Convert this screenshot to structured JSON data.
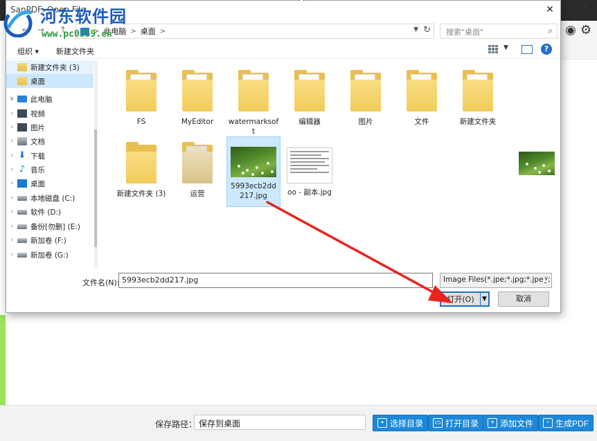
{
  "dialog": {
    "title": "SanPDF: Open File",
    "close_glyph": "✕",
    "nav": {
      "back": "←",
      "forward": "→",
      "up": "↑"
    },
    "address": {
      "segments": [
        "此电脑",
        "桌面"
      ],
      "sep": ">"
    },
    "search": {
      "placeholder": "搜索\"桌面\""
    },
    "toolbar": {
      "organize": "组织 ▾",
      "new_folder": "新建文件夹"
    },
    "help": "?",
    "nav_pane": [
      {
        "label": "新建文件夹 (3)",
        "icon": "folder-icon"
      },
      {
        "label": "桌面",
        "icon": "folder-icon"
      },
      {
        "label": "此电脑",
        "icon": "computer-icon"
      },
      {
        "label": "视频",
        "icon": "video-icon"
      },
      {
        "label": "图片",
        "icon": "pictures-icon"
      },
      {
        "label": "文档",
        "icon": "documents-icon"
      },
      {
        "label": "下载",
        "icon": "download-icon"
      },
      {
        "label": "音乐",
        "icon": "music-icon"
      },
      {
        "label": "桌面",
        "icon": "desktop-icon"
      },
      {
        "label": "本地磁盘 (C:)",
        "icon": "drive-icon"
      },
      {
        "label": "软件 (D:)",
        "icon": "drive-icon"
      },
      {
        "label": "备份[勿删] (E:)",
        "icon": "drive-icon"
      },
      {
        "label": "新加卷 (F:)",
        "icon": "drive-icon"
      },
      {
        "label": "新加卷 (G:)",
        "icon": "drive-icon"
      }
    ],
    "files": [
      {
        "name": "FS",
        "kind": "folder"
      },
      {
        "name": "MyEditor",
        "kind": "folder"
      },
      {
        "name": "watermarksoft",
        "kind": "folder"
      },
      {
        "name": "编辑器",
        "kind": "folder"
      },
      {
        "name": "图片",
        "kind": "folder"
      },
      {
        "name": "文件",
        "kind": "folder"
      },
      {
        "name": "新建文件夹",
        "kind": "folder"
      },
      {
        "name": "新建文件夹 (3)",
        "kind": "folder"
      },
      {
        "name": "运营",
        "kind": "folder"
      },
      {
        "name": "5993ecb2dd217.jpg",
        "kind": "image"
      },
      {
        "name": "oo - 副本.jpg",
        "kind": "document"
      }
    ],
    "filename_label": "文件名(N):",
    "filename_value": "5993ecb2dd217.jpg",
    "filetype_value": "Image Files(*.jpe;*.jpg;*.jpeg;",
    "open_label": "打开(O)",
    "cancel_label": "取消"
  },
  "app": {
    "save_path_label": "保存路径：",
    "save_path_value": "保存到桌面",
    "buttons": [
      "选择目录",
      "打开目录",
      "添加文件",
      "生成PDF"
    ],
    "accent": "#1e88d8"
  },
  "watermark": {
    "title": "河东软件园",
    "url": "www.pc0359.cn"
  },
  "annotation_color": "#e8221f"
}
